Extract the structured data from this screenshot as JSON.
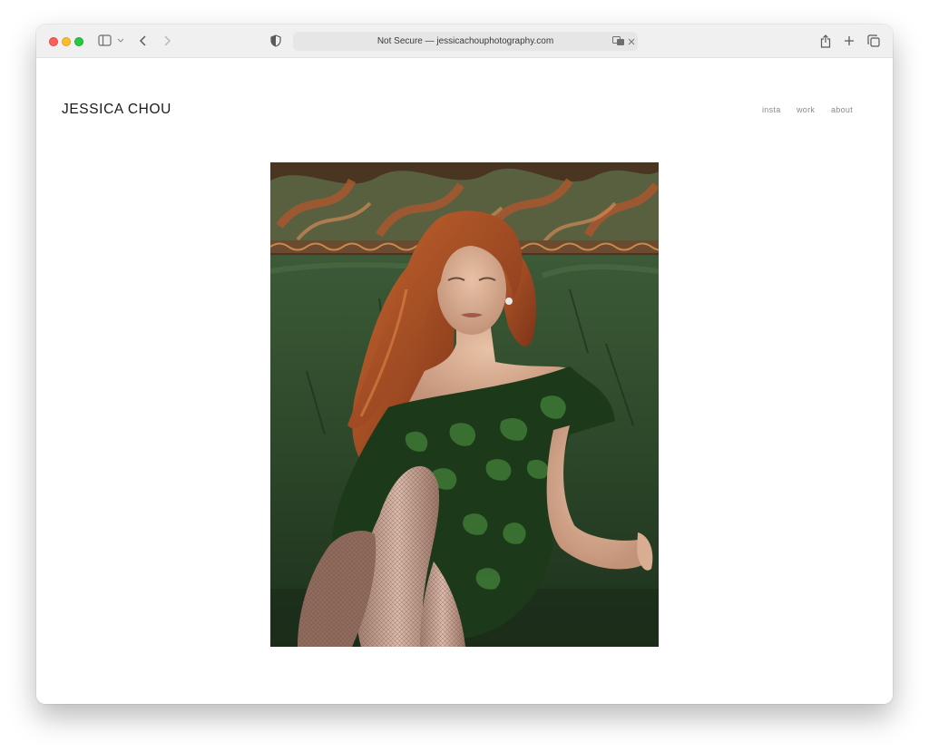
{
  "browser": {
    "address_text": "Not Secure — jessicachouphotography.com",
    "icons": {
      "sidebar": "sidebar-icon",
      "back": "chevron-left-icon",
      "forward": "chevron-right-icon",
      "shield": "shield-icon",
      "translate": "translate-icon",
      "stop": "close-icon",
      "share": "share-icon",
      "new_tab": "plus-icon",
      "tabs": "tab-overview-icon"
    }
  },
  "site": {
    "brand": "JESSICA CHOU",
    "nav": [
      {
        "label": "insta"
      },
      {
        "label": "work"
      },
      {
        "label": "about"
      }
    ]
  },
  "colors": {
    "traffic_red": "#fe5f57",
    "traffic_yellow": "#febc2e",
    "traffic_green": "#28c840",
    "photo_sofa_green": "#2f4a2d",
    "photo_hair": "#b3532a"
  }
}
